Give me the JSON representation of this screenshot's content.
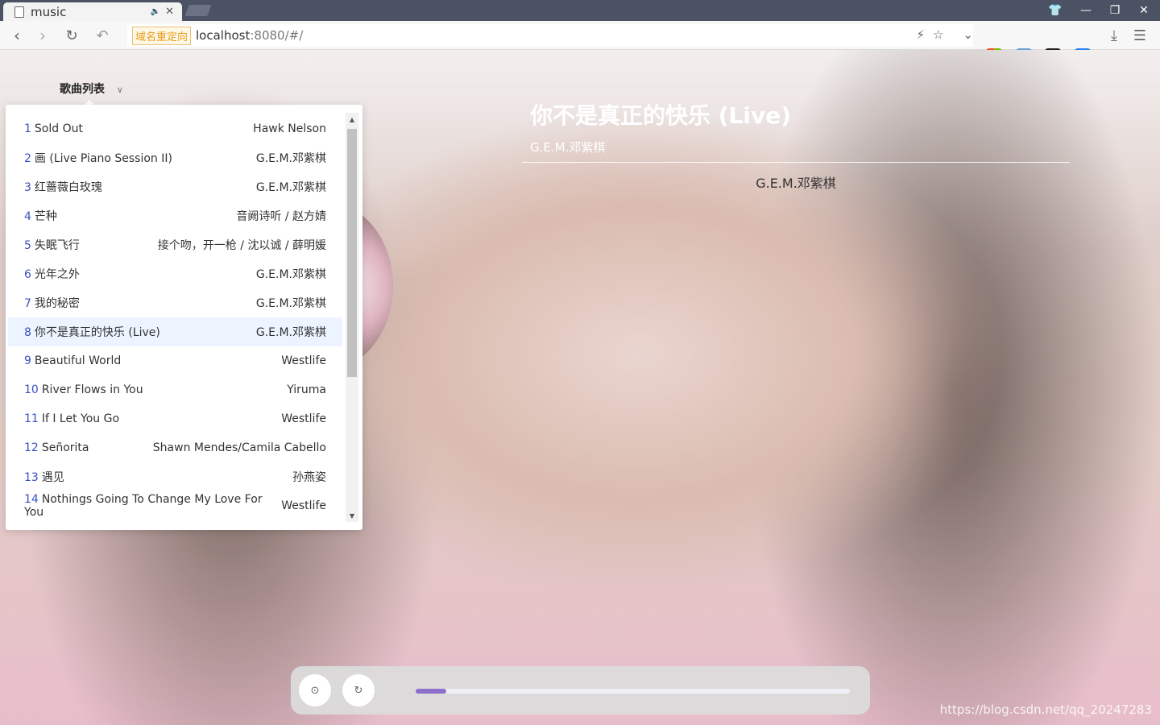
{
  "browser": {
    "tab_title": "music",
    "redirect_badge": "域名重定向",
    "url_host": "localhost",
    "url_rest": ":8080/#/"
  },
  "playlist": {
    "title": "歌曲列表",
    "songs": [
      {
        "num": "1",
        "title": "Sold Out",
        "artist": "Hawk Nelson"
      },
      {
        "num": "2",
        "title": "画 (Live Piano Session II)",
        "artist": "G.E.M.邓紫棋"
      },
      {
        "num": "3",
        "title": "红蔷薇白玫瑰",
        "artist": "G.E.M.邓紫棋"
      },
      {
        "num": "4",
        "title": "芒种",
        "artist": "音阙诗听 / 赵方婧"
      },
      {
        "num": "5",
        "title": "失眠飞行",
        "artist": "接个吻，开一枪 / 沈以诚 / 薛明媛"
      },
      {
        "num": "6",
        "title": "光年之外",
        "artist": "G.E.M.邓紫棋"
      },
      {
        "num": "7",
        "title": "我的秘密",
        "artist": "G.E.M.邓紫棋"
      },
      {
        "num": "8",
        "title": "你不是真正的快乐 (Live)",
        "artist": "G.E.M.邓紫棋"
      },
      {
        "num": "9",
        "title": "Beautiful World",
        "artist": "Westlife"
      },
      {
        "num": "10",
        "title": "River Flows in You",
        "artist": "Yiruma"
      },
      {
        "num": "11",
        "title": "If I Let You Go",
        "artist": "Westlife"
      },
      {
        "num": "12",
        "title": "Señorita",
        "artist": "Shawn Mendes/Camila Cabello"
      },
      {
        "num": "13",
        "title": "遇见",
        "artist": "孙燕姿"
      },
      {
        "num": "14",
        "title": "Nothings Going To Change My Love For You",
        "artist": "Westlife"
      }
    ]
  },
  "now_playing": {
    "title": "你不是真正的快乐 (Live)",
    "artist": "G.E.M.邓紫棋",
    "lyric": "G.E.M.邓紫棋"
  },
  "player": {
    "progress": 0.07
  },
  "watermark": "https://blog.csdn.net/qq_20247283"
}
